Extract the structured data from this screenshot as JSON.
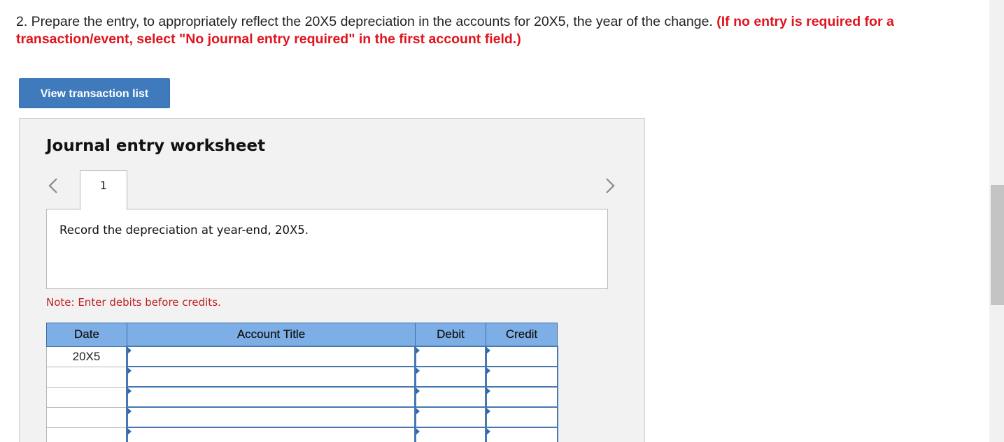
{
  "instructions": {
    "main": "2. Prepare the entry, to appropriately reflect the 20X5 depreciation in the accounts for 20X5, the year of the change. ",
    "emphasis": "(If no entry is required for a transaction/event, select \"No journal entry required\" in the first account field.)"
  },
  "buttons": {
    "view_transactions": "View transaction list"
  },
  "worksheet": {
    "title": "Journal entry worksheet",
    "tabs": [
      "1"
    ],
    "prompt": "Record the depreciation at year-end, 20X5.",
    "note": "Note: Enter debits before credits.",
    "columns": [
      "Date",
      "Account Title",
      "Debit",
      "Credit"
    ],
    "rows": [
      {
        "date": "20X5",
        "account": "",
        "debit": "",
        "credit": ""
      },
      {
        "date": "",
        "account": "",
        "debit": "",
        "credit": ""
      },
      {
        "date": "",
        "account": "",
        "debit": "",
        "credit": ""
      },
      {
        "date": "",
        "account": "",
        "debit": "",
        "credit": ""
      },
      {
        "date": "",
        "account": "",
        "debit": "",
        "credit": ""
      }
    ]
  },
  "colors": {
    "accent_button": "#3e7abc",
    "header_blue": "#7eaee6",
    "instruction_red": "#e0141e",
    "note_red": "#c22020"
  }
}
